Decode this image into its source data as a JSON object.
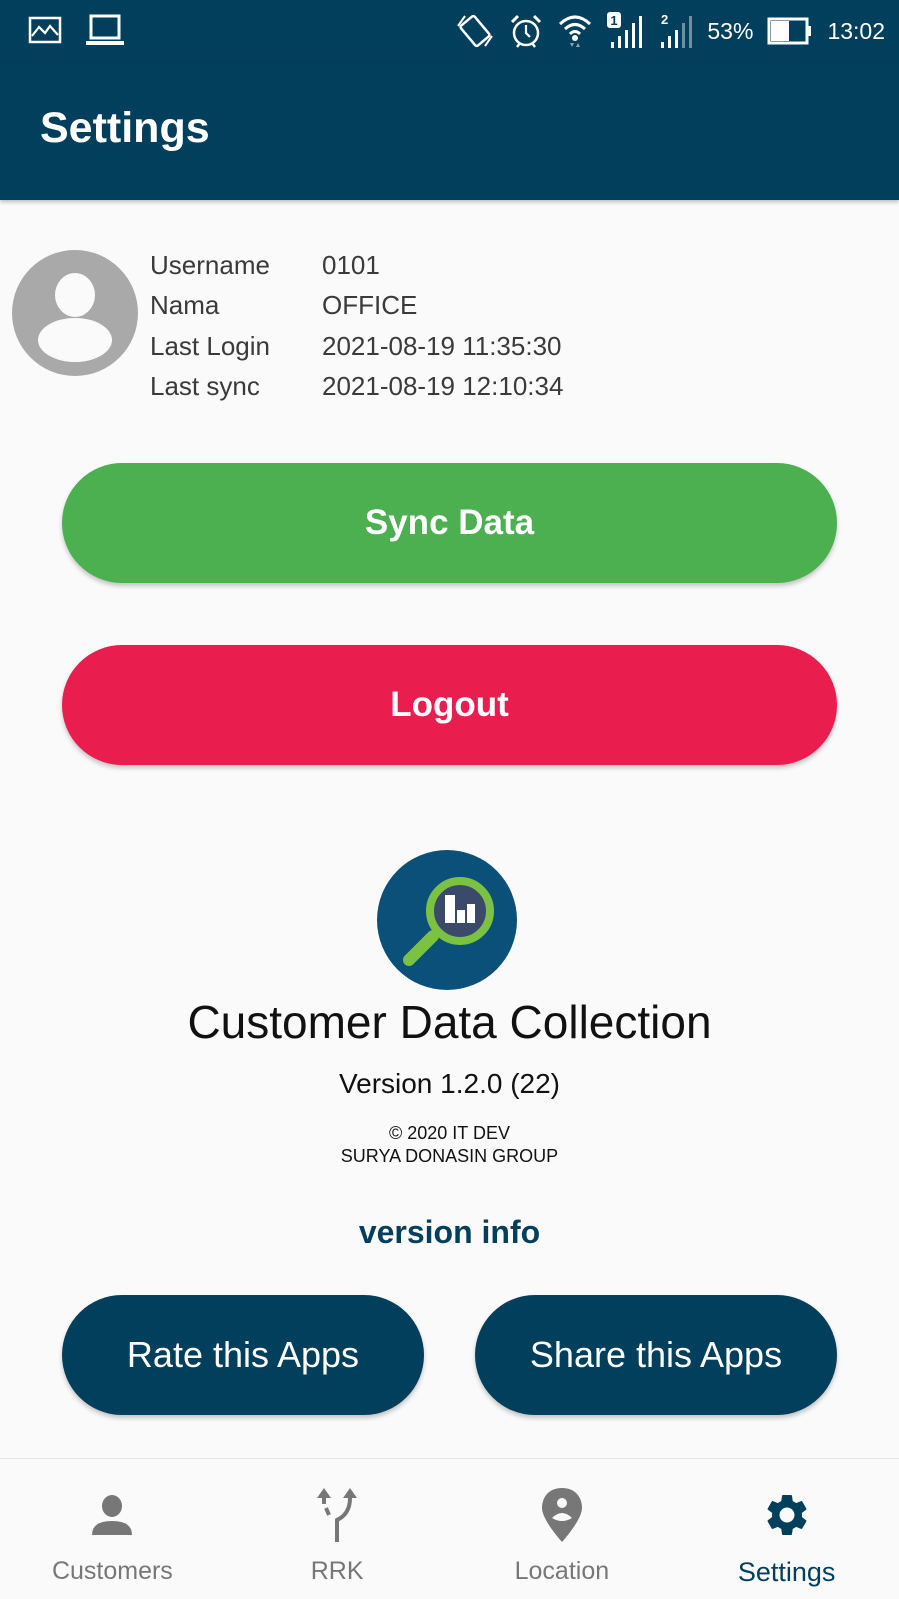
{
  "status_bar": {
    "left_icons": [
      "gallery-icon",
      "laptop-icon"
    ],
    "right_icons": [
      "vibrate-icon",
      "alarm-icon",
      "wifi-icon",
      "signal-sim1-icon",
      "signal-sim2-icon"
    ],
    "sim1_badge": "1",
    "sim2_badge": "2",
    "battery_percent": "53%",
    "battery_level": 0.53,
    "time": "13:02"
  },
  "app_bar": {
    "title": "Settings"
  },
  "profile": {
    "avatar_icon": "person-avatar-icon",
    "fields": [
      {
        "label": "Username",
        "value": "0101"
      },
      {
        "label": "Nama",
        "value": "OFFICE"
      },
      {
        "label": "Last Login",
        "value": "2021-08-19 11:35:30"
      },
      {
        "label": "Last sync",
        "value": "2021-08-19 12:10:34"
      }
    ]
  },
  "actions": {
    "sync_label": "Sync Data",
    "logout_label": "Logout"
  },
  "about": {
    "logo_icon": "magnifier-chart-logo",
    "app_name": "Customer Data Collection",
    "version": "Version 1.2.0 (22)",
    "copyright_line1": "© 2020 IT DEV",
    "copyright_line2": "SURYA DONASIN GROUP",
    "version_info_link": "version info",
    "rate_label": "Rate this Apps",
    "share_label": "Share this Apps"
  },
  "bottom_nav": {
    "items": [
      {
        "label": "Customers",
        "icon": "person-icon",
        "active": false
      },
      {
        "label": "RRK",
        "icon": "merge-arrows-icon",
        "active": false
      },
      {
        "label": "Location",
        "icon": "location-pin-icon",
        "active": false
      },
      {
        "label": "Settings",
        "icon": "gear-icon",
        "active": true
      }
    ]
  },
  "colors": {
    "primary": "#023f5c",
    "sync_green": "#4caf50",
    "logout_red": "#e91e4f",
    "logo_green": "#7cc242"
  }
}
